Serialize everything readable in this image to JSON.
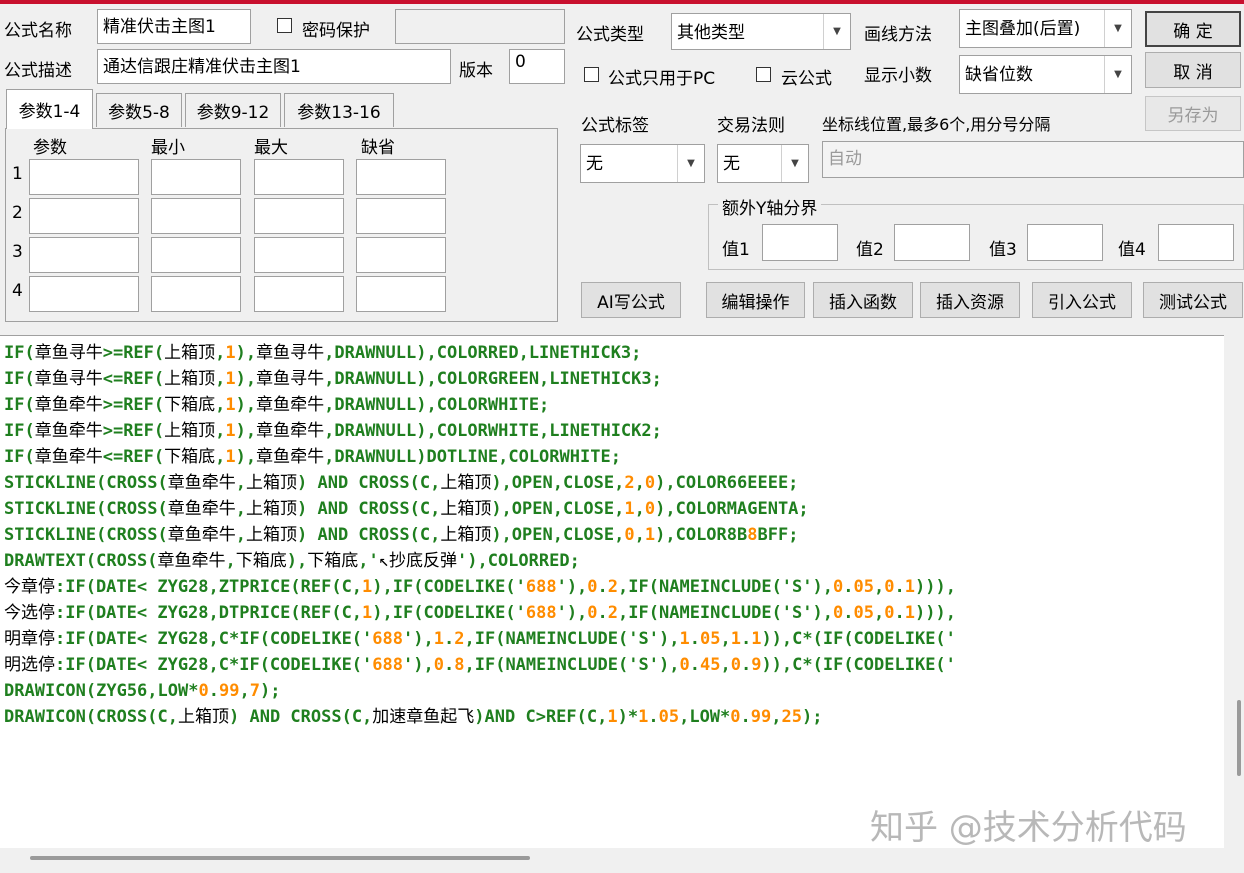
{
  "form": {
    "name_label": "公式名称",
    "name_value": "精准伏击主图1",
    "password_label": "密码保护",
    "desc_label": "公式描述",
    "desc_value": "通达信跟庄精准伏击主图1",
    "version_label": "版本",
    "version_value": "0",
    "type_label": "公式类型",
    "type_value": "其他类型",
    "draw_label": "画线方法",
    "draw_value": "主图叠加(后置)",
    "pc_only_label": "公式只用于PC",
    "cloud_label": "云公式",
    "decimals_label": "显示小数",
    "decimals_value": "缺省位数",
    "tag_label": "公式标签",
    "tag_value": "无",
    "rule_label": "交易法则",
    "rule_value": "无",
    "axis_label": "坐标线位置,最多6个,用分号分隔",
    "axis_placeholder": "自动",
    "extra_axis_label": "额外Y轴分界",
    "values": [
      "值1",
      "值2",
      "值3",
      "值4"
    ]
  },
  "buttons": {
    "ok": "确  定",
    "cancel": "取  消",
    "save_as": "另存为",
    "ai": "AI写公式",
    "edit": "编辑操作",
    "insert_func": "插入函数",
    "insert_res": "插入资源",
    "import": "引入公式",
    "test": "测试公式"
  },
  "tabs": [
    "参数1-4",
    "参数5-8",
    "参数9-12",
    "参数13-16"
  ],
  "params": {
    "headers": [
      "参数",
      "最小",
      "最大",
      "缺省"
    ],
    "rows": [
      "1",
      "2",
      "3",
      "4"
    ]
  },
  "code_lines": [
    "IF(章鱼寻牛>=REF(上箱顶,1),章鱼寻牛,DRAWNULL),COLORRED,LINETHICK3;",
    "IF(章鱼寻牛<=REF(上箱顶,1),章鱼寻牛,DRAWNULL),COLORGREEN,LINETHICK3;",
    "IF(章鱼牵牛>=REF(下箱底,1),章鱼牵牛,DRAWNULL),COLORWHITE;",
    "IF(章鱼牵牛>=REF(上箱顶,1),章鱼牵牛,DRAWNULL),COLORWHITE,LINETHICK2;",
    "IF(章鱼牵牛<=REF(下箱底,1),章鱼牵牛,DRAWNULL)DOTLINE,COLORWHITE;",
    "STICKLINE(CROSS(章鱼牵牛,上箱顶) AND CROSS(C,上箱顶),OPEN,CLOSE,2,0),COLOR66EEEE;",
    "STICKLINE(CROSS(章鱼牵牛,上箱顶) AND CROSS(C,上箱顶),OPEN,CLOSE,1,0),COLORMAGENTA;",
    "STICKLINE(CROSS(章鱼牵牛,上箱顶) AND CROSS(C,上箱顶),OPEN,CLOSE,0,1),COLOR8B8BFF;",
    "DRAWTEXT(CROSS(章鱼牵牛,下箱底),下箱底,'↖抄底反弹'),COLORRED;",
    "今章停:IF(DATE< ZYG28,ZTPRICE(REF(C,1),IF(CODELIKE('688'),0.2,IF(NAMEINCLUDE('S'),0.05,0.1))),",
    "今选停:IF(DATE< ZYG28,DTPRICE(REF(C,1),IF(CODELIKE('688'),0.2,IF(NAMEINCLUDE('S'),0.05,0.1))),",
    "明章停:IF(DATE< ZYG28,C*IF(CODELIKE('688'),1.2,IF(NAMEINCLUDE('S'),1.05,1.1)),C*(IF(CODELIKE('",
    "明选停:IF(DATE< ZYG28,C*IF(CODELIKE('688'),0.8,IF(NAMEINCLUDE('S'),0.45,0.9)),C*(IF(CODELIKE('",
    "DRAWICON(ZYG56,LOW*0.99,7);",
    "DRAWICON(CROSS(C,上箱顶) AND CROSS(C,加速章鱼起飞)AND C>REF(C,1)*1.05,LOW*0.99,25);"
  ],
  "watermark": "知乎 @技术分析代码"
}
